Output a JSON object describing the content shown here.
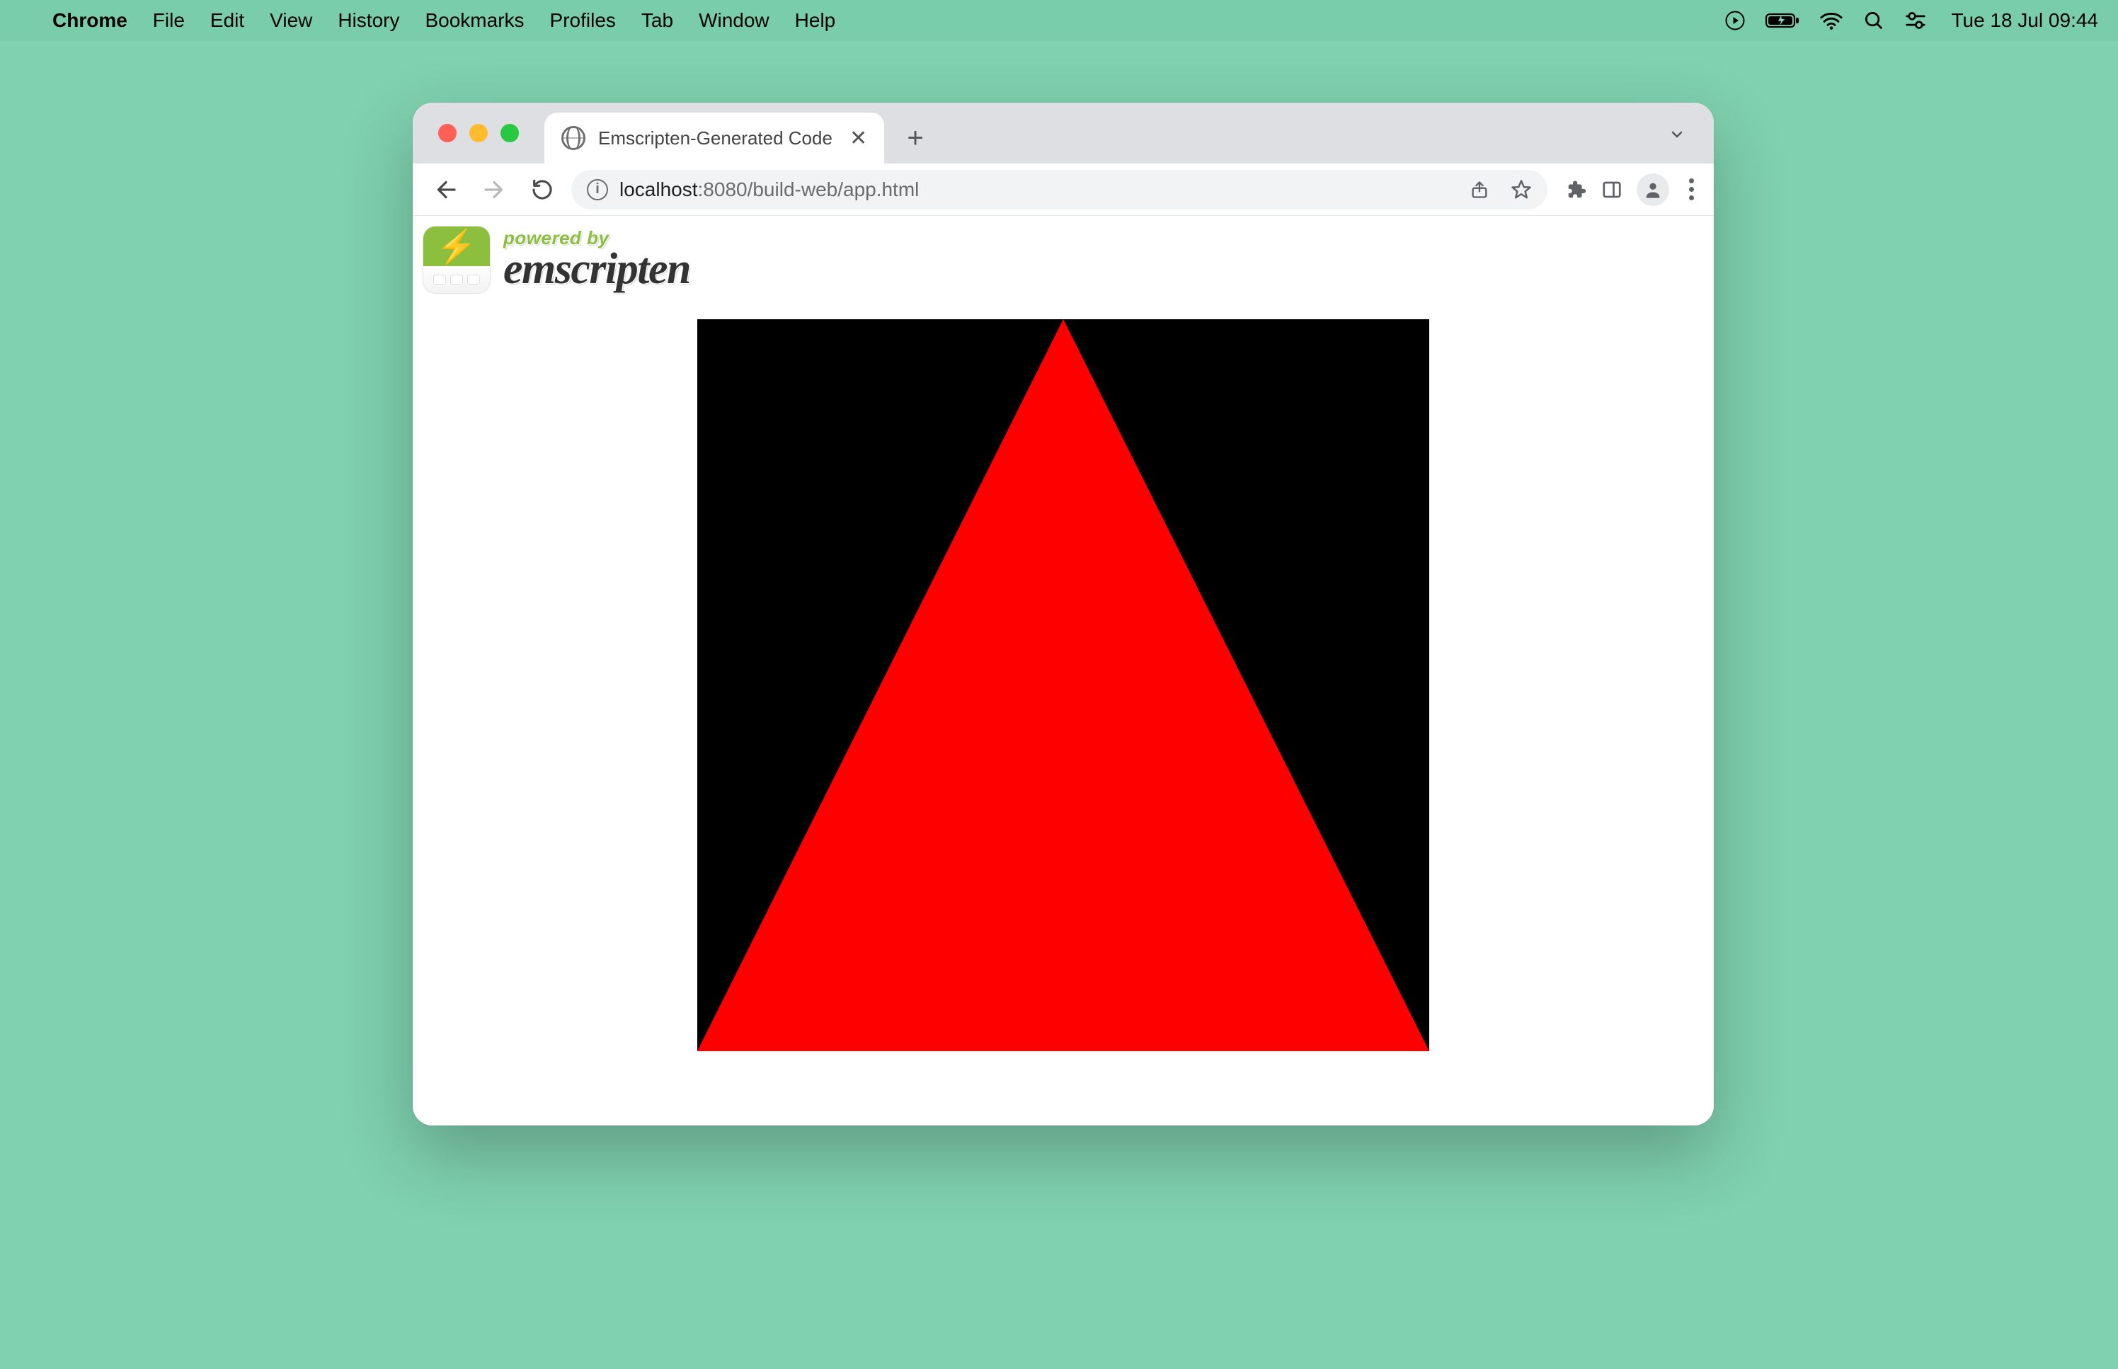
{
  "os": {
    "app_name": "Chrome",
    "menu_items": [
      "File",
      "Edit",
      "View",
      "History",
      "Bookmarks",
      "Profiles",
      "Tab",
      "Window",
      "Help"
    ],
    "datetime": "Tue 18 Jul  09:44"
  },
  "browser": {
    "tab": {
      "title": "Emscripten-Generated Code"
    },
    "url": {
      "host_muted_prefix": "localhost",
      "host_muted_suffix": ":8080/build-web/app.html"
    }
  },
  "page": {
    "powered_by": "powered by",
    "brand": "emscripten",
    "canvas": {
      "bg_color": "#000000",
      "triangle_color": "#FF0000"
    }
  }
}
